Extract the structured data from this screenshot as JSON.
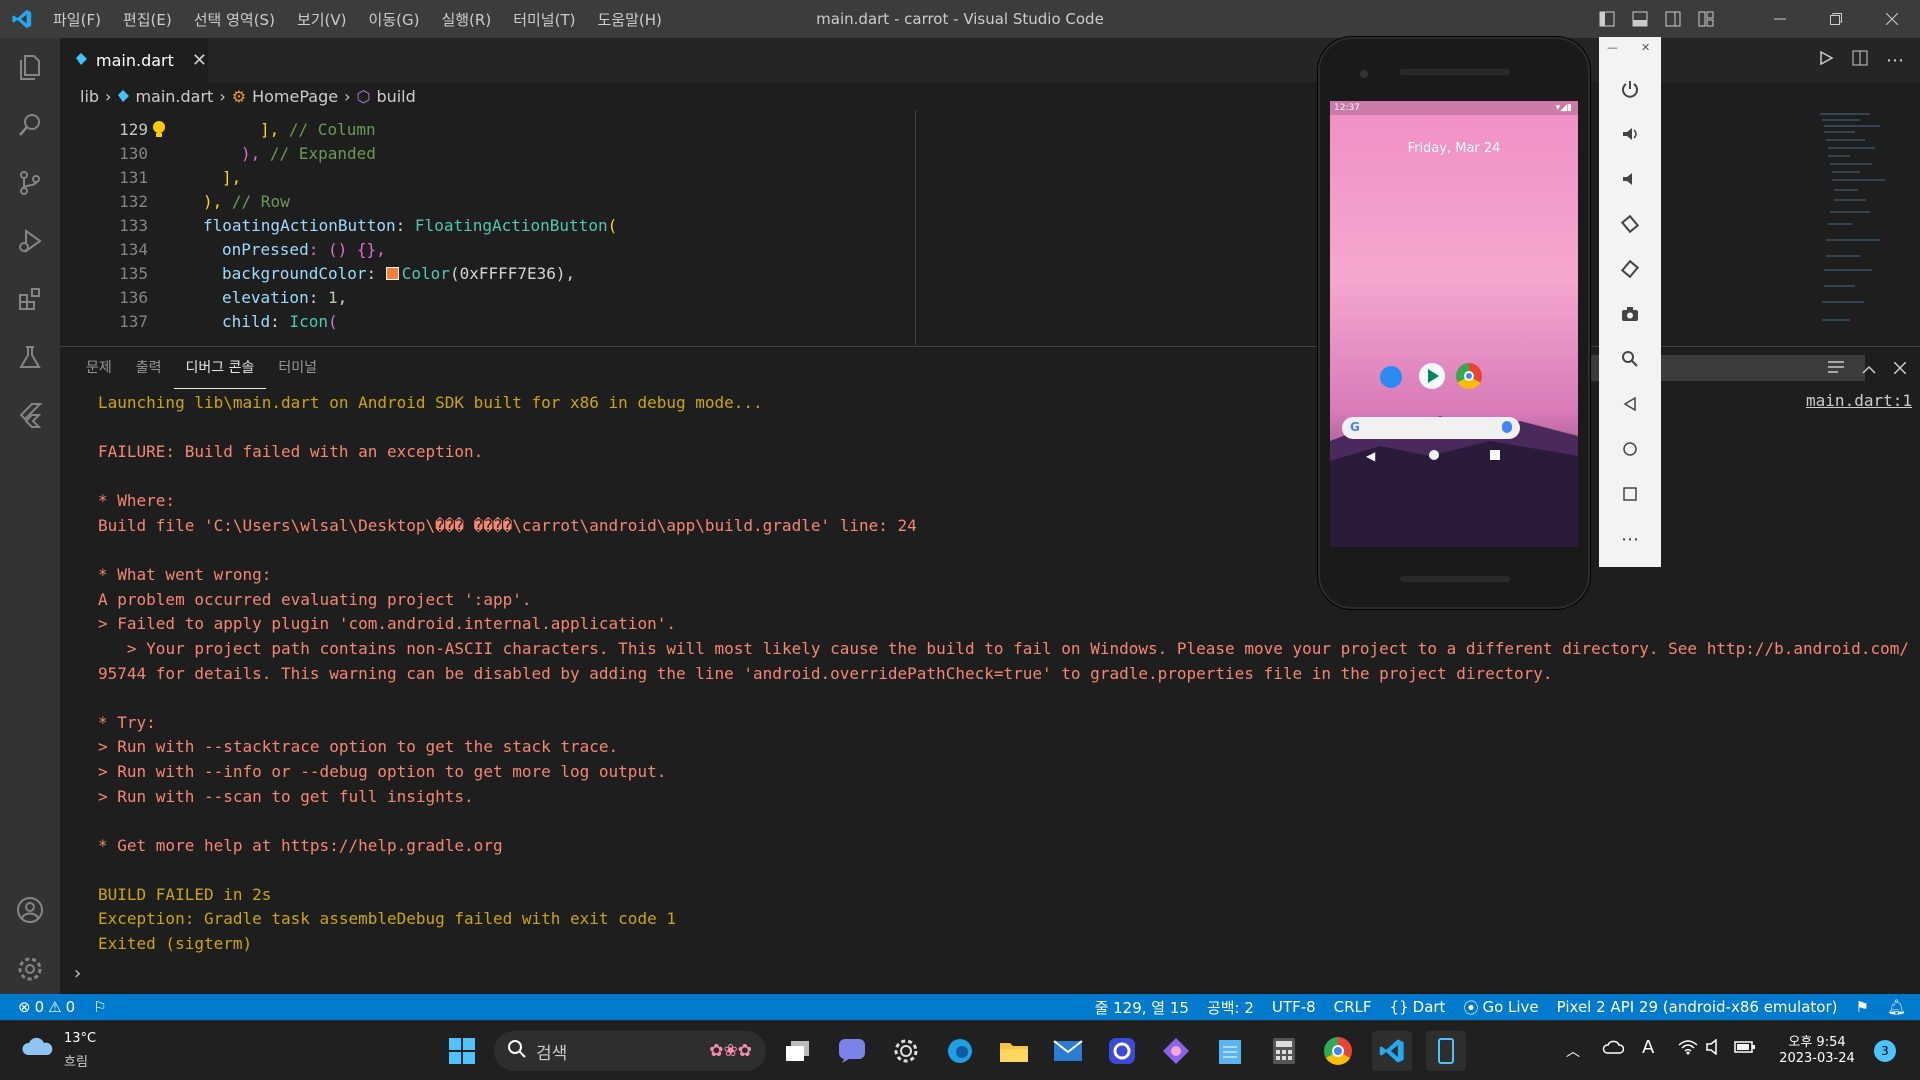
{
  "window": {
    "title": "main.dart - carrot - Visual Studio Code"
  },
  "menu": [
    "파일(F)",
    "편집(E)",
    "선택 영역(S)",
    "보기(V)",
    "이동(G)",
    "실행(R)",
    "터미널(T)",
    "도움말(H)"
  ],
  "tab": {
    "label": "main.dart"
  },
  "breadcrumb": {
    "lib": "lib",
    "file": "main.dart",
    "class": "HomePage",
    "method": "build"
  },
  "editor": {
    "line_numbers": [
      "129",
      "130",
      "131",
      "132",
      "133",
      "134",
      "135",
      "136",
      "137"
    ],
    "lines": [
      {
        "p": "], ",
        "c": "// Column"
      },
      {
        "p": "), ",
        "c": "// Expanded"
      },
      {
        "p": "],"
      },
      {
        "p": "), ",
        "c": "// Row"
      },
      {
        "k": "floatingActionButton",
        "p": ": ",
        "t": "FloatingActionButton",
        "q": "("
      },
      {
        "k": "onPressed",
        "p": ": () {},"
      },
      {
        "k": "backgroundColor",
        "p": ": ",
        "t": "Color",
        "q": "(0xFFFF7E36),"
      },
      {
        "k": "elevation",
        "p": ": ",
        "n": "1",
        "q": ","
      },
      {
        "k": "child",
        "p": ": ",
        "t": "Icon",
        "q": "("
      }
    ]
  },
  "panel": {
    "tabs": [
      "문제",
      "출력",
      "디버그 콘솔",
      "터미널"
    ],
    "active_tab": "디버그 콘솔",
    "location": "main.dart:1",
    "console": [
      {
        "text": "Launching lib\\main.dart on Android SDK built for x86 in debug mode...",
        "color": "ye"
      },
      {
        "text": "",
        "color": "or"
      },
      {
        "text": "FAILURE: Build failed with an exception.",
        "color": "or"
      },
      {
        "text": "",
        "color": "or"
      },
      {
        "text": "* Where:",
        "color": "or"
      },
      {
        "text": "Build file 'C:\\Users\\wlsal\\Desktop\\��� ����\\carrot\\android\\app\\build.gradle' line: 24",
        "color": "or"
      },
      {
        "text": "",
        "color": "or"
      },
      {
        "text": "* What went wrong:",
        "color": "or"
      },
      {
        "text": "A problem occurred evaluating project ':app'.",
        "color": "or"
      },
      {
        "text": "> Failed to apply plugin 'com.android.internal.application'.",
        "color": "or"
      },
      {
        "text": "   > Your project path contains non-ASCII characters. This will most likely cause the build to fail on Windows. Please move your project to a different directory. See http://b.android.com/95744 for details. This warning can be disabled by adding the line 'android.overridePathCheck=true' to gradle.properties file in the project directory.",
        "color": "or"
      },
      {
        "text": "",
        "color": "or"
      },
      {
        "text": "* Try:",
        "color": "or"
      },
      {
        "text": "> Run with --stacktrace option to get the stack trace.",
        "color": "or"
      },
      {
        "text": "> Run with --info or --debug option to get more log output.",
        "color": "or"
      },
      {
        "text": "> Run with --scan to get full insights.",
        "color": "or"
      },
      {
        "text": "",
        "color": "or"
      },
      {
        "text": "* Get more help at https://help.gradle.org",
        "color": "or"
      },
      {
        "text": "",
        "color": "or"
      },
      {
        "text": "BUILD FAILED in 2s",
        "color": "ye"
      },
      {
        "text": "Exception: Gradle task assembleDebug failed with exit code 1",
        "color": "ye"
      },
      {
        "text": "Exited (sigterm)",
        "color": "ye"
      }
    ]
  },
  "status": {
    "errors": "0",
    "warnings": "0",
    "position": "줄 129, 열 15",
    "spaces": "공백: 2",
    "encoding": "UTF-8",
    "eol": "CRLF",
    "language": "Dart",
    "golive": "Go Live",
    "device": "Pixel 2 API 29 (android-x86 emulator)"
  },
  "emulator": {
    "time": "12:37",
    "date": "Friday, Mar 24"
  },
  "taskbar": {
    "weather_temp": "13°C",
    "weather_desc": "흐림",
    "search_label": "검색",
    "time": "오후 9:54",
    "date": "2023-03-24",
    "notifications": "3"
  },
  "colors": {
    "accent": "#007acc",
    "fab_color": "#FF7E36"
  }
}
